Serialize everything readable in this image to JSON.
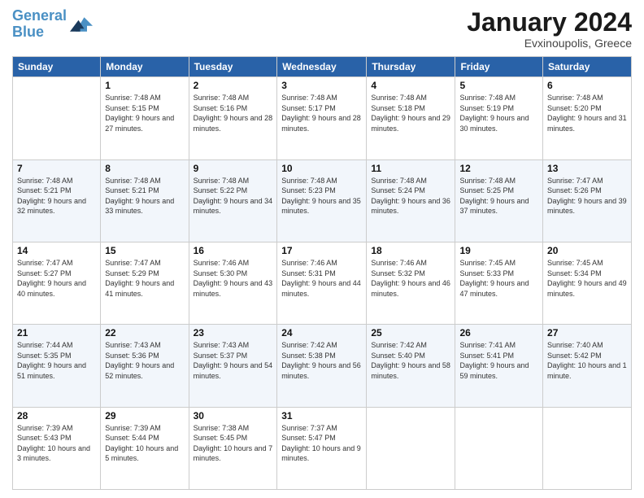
{
  "logo": {
    "line1": "General",
    "line2": "Blue"
  },
  "title": "January 2024",
  "location": "Evxinoupolis, Greece",
  "weekdays": [
    "Sunday",
    "Monday",
    "Tuesday",
    "Wednesday",
    "Thursday",
    "Friday",
    "Saturday"
  ],
  "weeks": [
    [
      {
        "day": "",
        "sunrise": "",
        "sunset": "",
        "daylight": ""
      },
      {
        "day": "1",
        "sunrise": "7:48 AM",
        "sunset": "5:15 PM",
        "daylight": "9 hours and 27 minutes."
      },
      {
        "day": "2",
        "sunrise": "7:48 AM",
        "sunset": "5:16 PM",
        "daylight": "9 hours and 28 minutes."
      },
      {
        "day": "3",
        "sunrise": "7:48 AM",
        "sunset": "5:17 PM",
        "daylight": "9 hours and 28 minutes."
      },
      {
        "day": "4",
        "sunrise": "7:48 AM",
        "sunset": "5:18 PM",
        "daylight": "9 hours and 29 minutes."
      },
      {
        "day": "5",
        "sunrise": "7:48 AM",
        "sunset": "5:19 PM",
        "daylight": "9 hours and 30 minutes."
      },
      {
        "day": "6",
        "sunrise": "7:48 AM",
        "sunset": "5:20 PM",
        "daylight": "9 hours and 31 minutes."
      }
    ],
    [
      {
        "day": "7",
        "sunrise": "7:48 AM",
        "sunset": "5:21 PM",
        "daylight": "9 hours and 32 minutes."
      },
      {
        "day": "8",
        "sunrise": "7:48 AM",
        "sunset": "5:21 PM",
        "daylight": "9 hours and 33 minutes."
      },
      {
        "day": "9",
        "sunrise": "7:48 AM",
        "sunset": "5:22 PM",
        "daylight": "9 hours and 34 minutes."
      },
      {
        "day": "10",
        "sunrise": "7:48 AM",
        "sunset": "5:23 PM",
        "daylight": "9 hours and 35 minutes."
      },
      {
        "day": "11",
        "sunrise": "7:48 AM",
        "sunset": "5:24 PM",
        "daylight": "9 hours and 36 minutes."
      },
      {
        "day": "12",
        "sunrise": "7:48 AM",
        "sunset": "5:25 PM",
        "daylight": "9 hours and 37 minutes."
      },
      {
        "day": "13",
        "sunrise": "7:47 AM",
        "sunset": "5:26 PM",
        "daylight": "9 hours and 39 minutes."
      }
    ],
    [
      {
        "day": "14",
        "sunrise": "7:47 AM",
        "sunset": "5:27 PM",
        "daylight": "9 hours and 40 minutes."
      },
      {
        "day": "15",
        "sunrise": "7:47 AM",
        "sunset": "5:29 PM",
        "daylight": "9 hours and 41 minutes."
      },
      {
        "day": "16",
        "sunrise": "7:46 AM",
        "sunset": "5:30 PM",
        "daylight": "9 hours and 43 minutes."
      },
      {
        "day": "17",
        "sunrise": "7:46 AM",
        "sunset": "5:31 PM",
        "daylight": "9 hours and 44 minutes."
      },
      {
        "day": "18",
        "sunrise": "7:46 AM",
        "sunset": "5:32 PM",
        "daylight": "9 hours and 46 minutes."
      },
      {
        "day": "19",
        "sunrise": "7:45 AM",
        "sunset": "5:33 PM",
        "daylight": "9 hours and 47 minutes."
      },
      {
        "day": "20",
        "sunrise": "7:45 AM",
        "sunset": "5:34 PM",
        "daylight": "9 hours and 49 minutes."
      }
    ],
    [
      {
        "day": "21",
        "sunrise": "7:44 AM",
        "sunset": "5:35 PM",
        "daylight": "9 hours and 51 minutes."
      },
      {
        "day": "22",
        "sunrise": "7:43 AM",
        "sunset": "5:36 PM",
        "daylight": "9 hours and 52 minutes."
      },
      {
        "day": "23",
        "sunrise": "7:43 AM",
        "sunset": "5:37 PM",
        "daylight": "9 hours and 54 minutes."
      },
      {
        "day": "24",
        "sunrise": "7:42 AM",
        "sunset": "5:38 PM",
        "daylight": "9 hours and 56 minutes."
      },
      {
        "day": "25",
        "sunrise": "7:42 AM",
        "sunset": "5:40 PM",
        "daylight": "9 hours and 58 minutes."
      },
      {
        "day": "26",
        "sunrise": "7:41 AM",
        "sunset": "5:41 PM",
        "daylight": "9 hours and 59 minutes."
      },
      {
        "day": "27",
        "sunrise": "7:40 AM",
        "sunset": "5:42 PM",
        "daylight": "10 hours and 1 minute."
      }
    ],
    [
      {
        "day": "28",
        "sunrise": "7:39 AM",
        "sunset": "5:43 PM",
        "daylight": "10 hours and 3 minutes."
      },
      {
        "day": "29",
        "sunrise": "7:39 AM",
        "sunset": "5:44 PM",
        "daylight": "10 hours and 5 minutes."
      },
      {
        "day": "30",
        "sunrise": "7:38 AM",
        "sunset": "5:45 PM",
        "daylight": "10 hours and 7 minutes."
      },
      {
        "day": "31",
        "sunrise": "7:37 AM",
        "sunset": "5:47 PM",
        "daylight": "10 hours and 9 minutes."
      },
      {
        "day": "",
        "sunrise": "",
        "sunset": "",
        "daylight": ""
      },
      {
        "day": "",
        "sunrise": "",
        "sunset": "",
        "daylight": ""
      },
      {
        "day": "",
        "sunrise": "",
        "sunset": "",
        "daylight": ""
      }
    ]
  ]
}
